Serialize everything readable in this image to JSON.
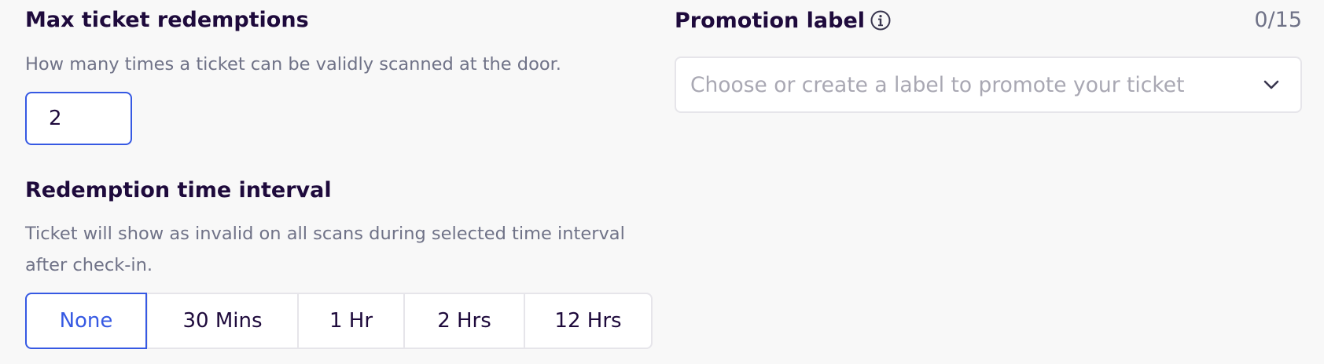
{
  "max_redemptions": {
    "title": "Max ticket redemptions",
    "help": "How many times a ticket can be validly scanned at the door.",
    "value": "2"
  },
  "redemption_interval": {
    "title": "Redemption time interval",
    "help": "Ticket will show as invalid on all scans during selected time interval after check-in.",
    "options": [
      "None",
      "30 Mins",
      "1 Hr",
      "2 Hrs",
      "12 Hrs"
    ],
    "selected": "None"
  },
  "promotion_label": {
    "title": "Promotion label",
    "counter": "0/15",
    "placeholder": "Choose or create a label to promote your ticket",
    "info_icon": "info-circle-icon",
    "chevron_icon": "chevron-down-icon"
  },
  "colors": {
    "accent": "#3659e3",
    "text_primary": "#1e0a3c",
    "text_secondary": "#6f7287",
    "border": "#e6e5ea",
    "background": "#f8f8f8"
  }
}
